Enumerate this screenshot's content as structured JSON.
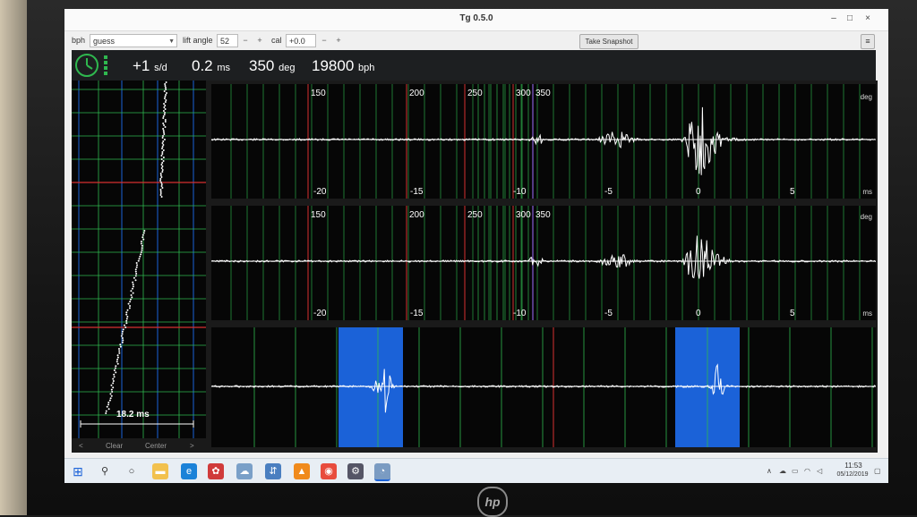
{
  "window": {
    "title": "Tg 0.5.0"
  },
  "toolbar": {
    "bph_label": "bph",
    "bph_value": "guess",
    "lift_angle_label": "lift angle",
    "lift_angle_value": "52",
    "cal_label": "cal",
    "cal_value": "+0.0",
    "minus": "−",
    "plus": "+",
    "snapshot_label": "Take Snapshot",
    "menu_icon": "≡"
  },
  "status": {
    "rate_value": "+1",
    "rate_unit": "s/d",
    "beat_error_value": "0.2",
    "beat_error_unit": "ms",
    "amplitude_value": "350",
    "amplitude_unit": "deg",
    "bph_value": "19800",
    "bph_unit": "bph"
  },
  "paper_strip": {
    "scale_label": "18.2 ms"
  },
  "waveforms": {
    "deg_ticks": [
      "150",
      "200",
      "250",
      "300",
      "350"
    ],
    "ms_ticks": [
      "-20",
      "-15",
      "-10",
      "-5",
      "0",
      "5"
    ],
    "deg_unit": "deg",
    "ms_unit": "ms"
  },
  "bottom_controls": {
    "prev": "<",
    "clear": "Clear",
    "center": "Center",
    "next": ">"
  },
  "taskbar": {
    "time": "11:53",
    "date": "05/12/2019",
    "icons": [
      "windows-start-icon",
      "search-icon",
      "cortana-icon",
      "folder-icon",
      "edge-icon",
      "photos-icon",
      "onedrive-icon",
      "network-app-icon",
      "vlc-icon",
      "chrome-icon",
      "settings-icon",
      "tg-app-icon"
    ]
  },
  "colors": {
    "accent_blue": "#1b62d8",
    "grid_red": "#d63030",
    "grid_green": "#2fb84f",
    "signal": "#ffffff"
  }
}
